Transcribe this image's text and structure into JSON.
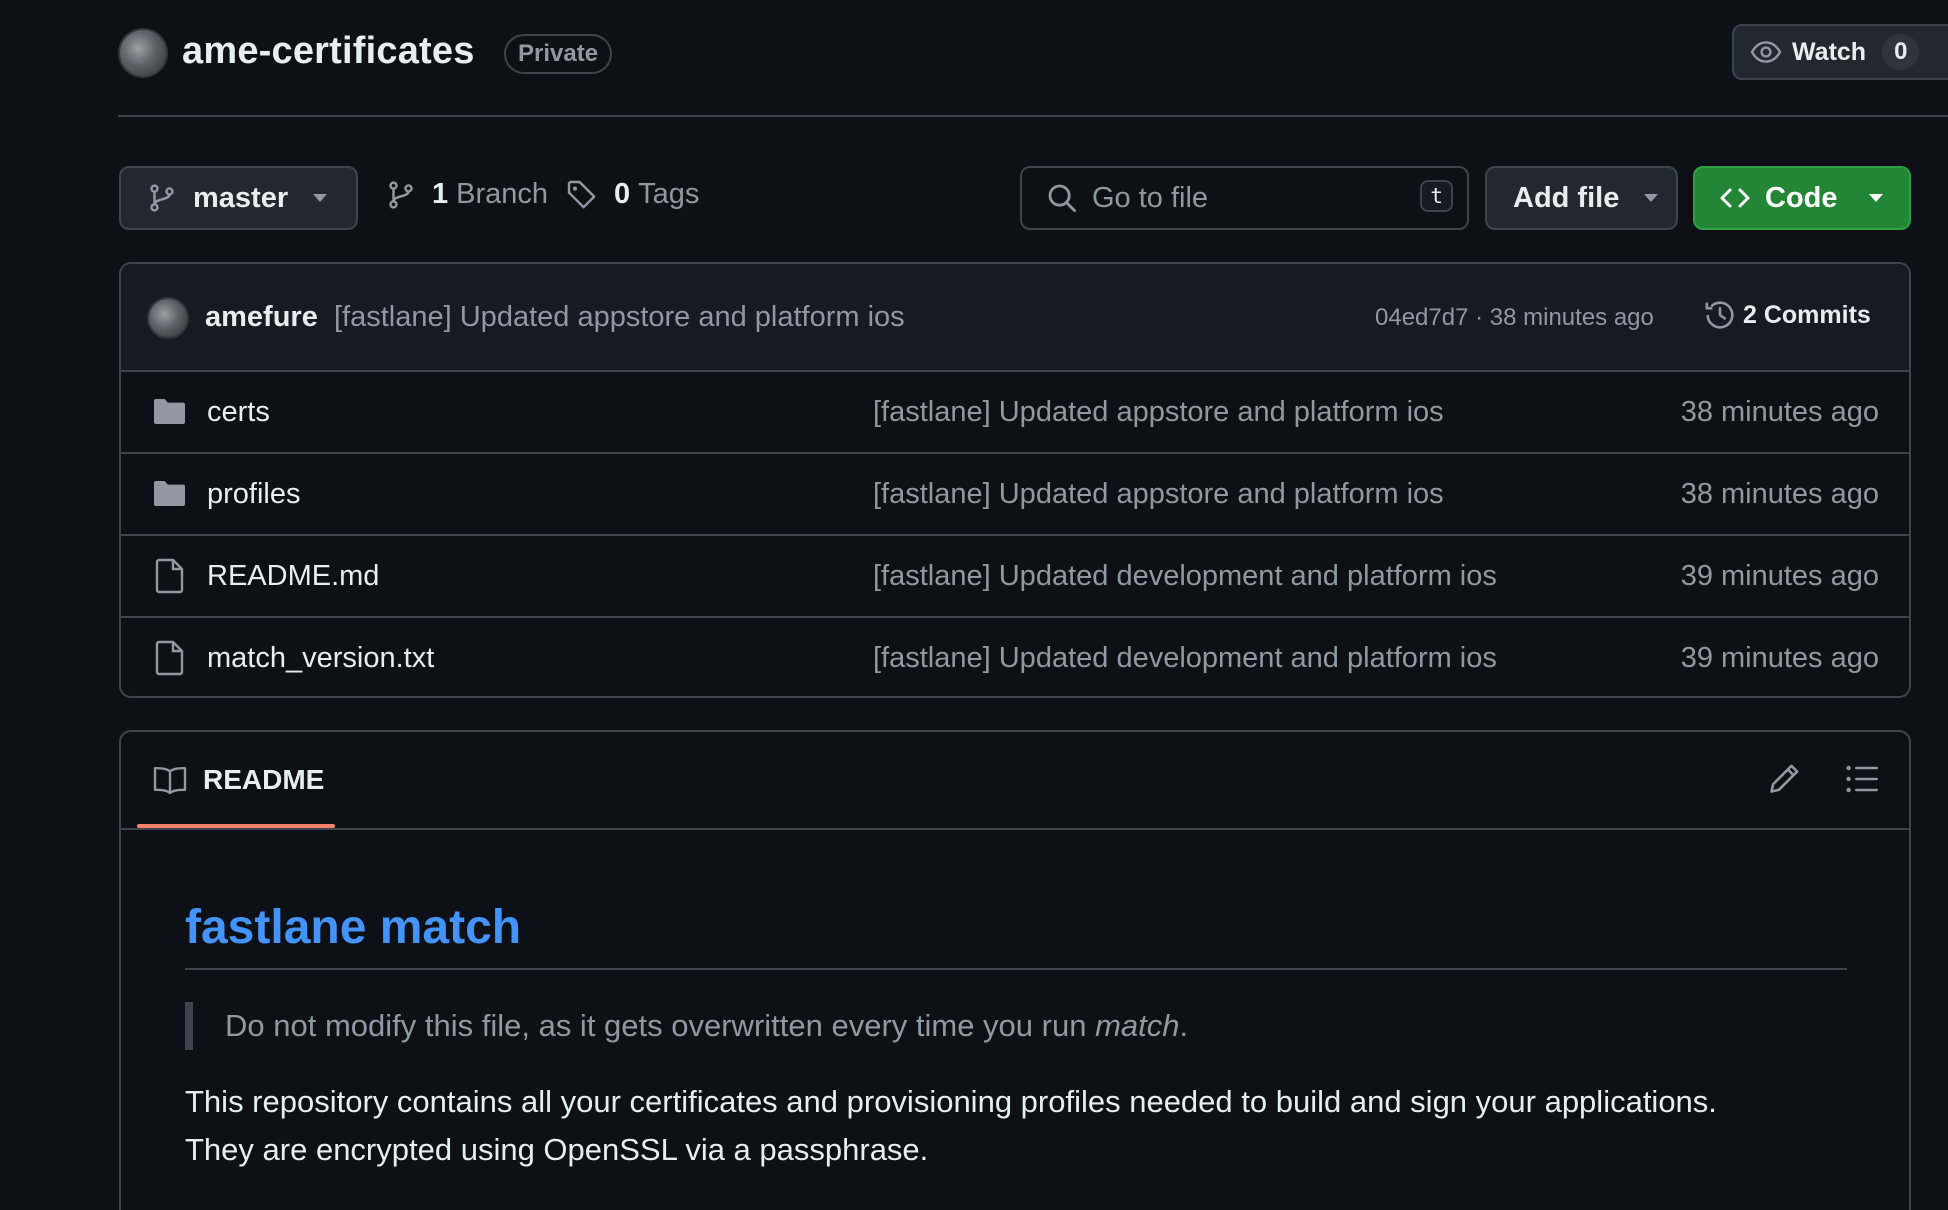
{
  "repo": {
    "name": "ame-certificates",
    "visibility": "Private",
    "watch_label": "Watch",
    "watch_count": "0"
  },
  "toolbar": {
    "branch": "master",
    "branch_count": "1",
    "branch_label": "Branch",
    "tag_count": "0",
    "tag_label": "Tags",
    "search_placeholder": "Go to file",
    "search_shortcut": "t",
    "add_file_label": "Add file",
    "code_label": "Code"
  },
  "latest_commit": {
    "author": "amefure",
    "message": "[fastlane] Updated appstore and platform ios",
    "sha_time": "04ed7d7 · 38 minutes ago",
    "commits_label": "2 Commits"
  },
  "files": [
    {
      "name": "certs",
      "type": "folder",
      "message": "[fastlane] Updated appstore and platform ios",
      "age": "38 minutes ago"
    },
    {
      "name": "profiles",
      "type": "folder",
      "message": "[fastlane] Updated appstore and platform ios",
      "age": "38 minutes ago"
    },
    {
      "name": "README.md",
      "type": "file",
      "message": "[fastlane] Updated development and platform ios",
      "age": "39 minutes ago"
    },
    {
      "name": "match_version.txt",
      "type": "file",
      "message": "[fastlane] Updated development and platform ios",
      "age": "39 minutes ago"
    }
  ],
  "readme": {
    "tab_label": "README",
    "heading": "fastlane match",
    "quote_prefix": "Do not modify this file, as it gets overwritten every time you run ",
    "quote_em": "match",
    "quote_suffix": ".",
    "paragraph_line1": "This repository contains all your certificates and provisioning profiles needed to build and sign your applications.",
    "paragraph_line2": "They are encrypted using OpenSSL via a passphrase."
  },
  "colors": {
    "background": "#0d1117",
    "border": "#3d444d",
    "accent_green": "#238636",
    "link_blue": "#4493f8",
    "tab_underline": "#f78166"
  }
}
